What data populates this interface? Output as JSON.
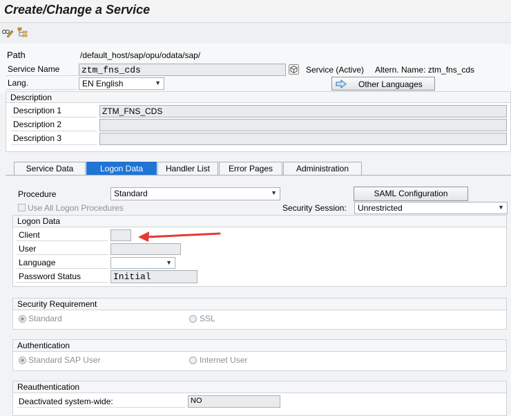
{
  "title": "Create/Change a Service",
  "toolbar": {
    "icons": [
      "display-change-icon",
      "hierarchy-icon"
    ]
  },
  "header": {
    "path_label": "Path",
    "path_value": "/default_host/sap/opu/odata/sap/",
    "service_name_label": "Service Name",
    "service_name_value": "ztm_fns_cds",
    "service_status": "Service (Active)",
    "altern_name": "Altern. Name: ztm_fns_cds",
    "lang_label": "Lang.",
    "lang_value": "EN English",
    "other_languages_label": "Other Languages"
  },
  "description": {
    "header": "Description",
    "rows": [
      {
        "label": "Description 1",
        "value": "ZTM_FNS_CDS"
      },
      {
        "label": "Description 2",
        "value": ""
      },
      {
        "label": "Description 3",
        "value": ""
      }
    ]
  },
  "tabs": [
    {
      "label": "Service Data"
    },
    {
      "label": "Logon Data",
      "active": true
    },
    {
      "label": "Handler List"
    },
    {
      "label": "Error Pages"
    },
    {
      "label": "Administration"
    }
  ],
  "logon": {
    "procedure_label": "Procedure",
    "procedure_value": "Standard",
    "saml_button": "SAML Configuration",
    "use_all_label": "Use All Logon Procedures",
    "security_session_label": "Security Session:",
    "security_session_value": "Unrestricted",
    "logon_data_header": "Logon Data",
    "client_label": "Client",
    "client_value": "",
    "user_label": "User",
    "user_value": "",
    "language_label": "Language",
    "language_value": "",
    "password_status_label": "Password Status",
    "password_status_value": "Initial"
  },
  "security_requirement": {
    "header": "Security Requirement",
    "option_standard": "Standard",
    "option_ssl": "SSL"
  },
  "authentication": {
    "header": "Authentication",
    "option_standard": "Standard SAP User",
    "option_internet": "Internet User"
  },
  "reauthentication": {
    "header": "Reauthentication",
    "deactivated_label": "Deactivated system-wide:",
    "deactivated_value": "NO"
  },
  "colors": {
    "accent": "#1f74d4",
    "arrow": "#e53935"
  }
}
